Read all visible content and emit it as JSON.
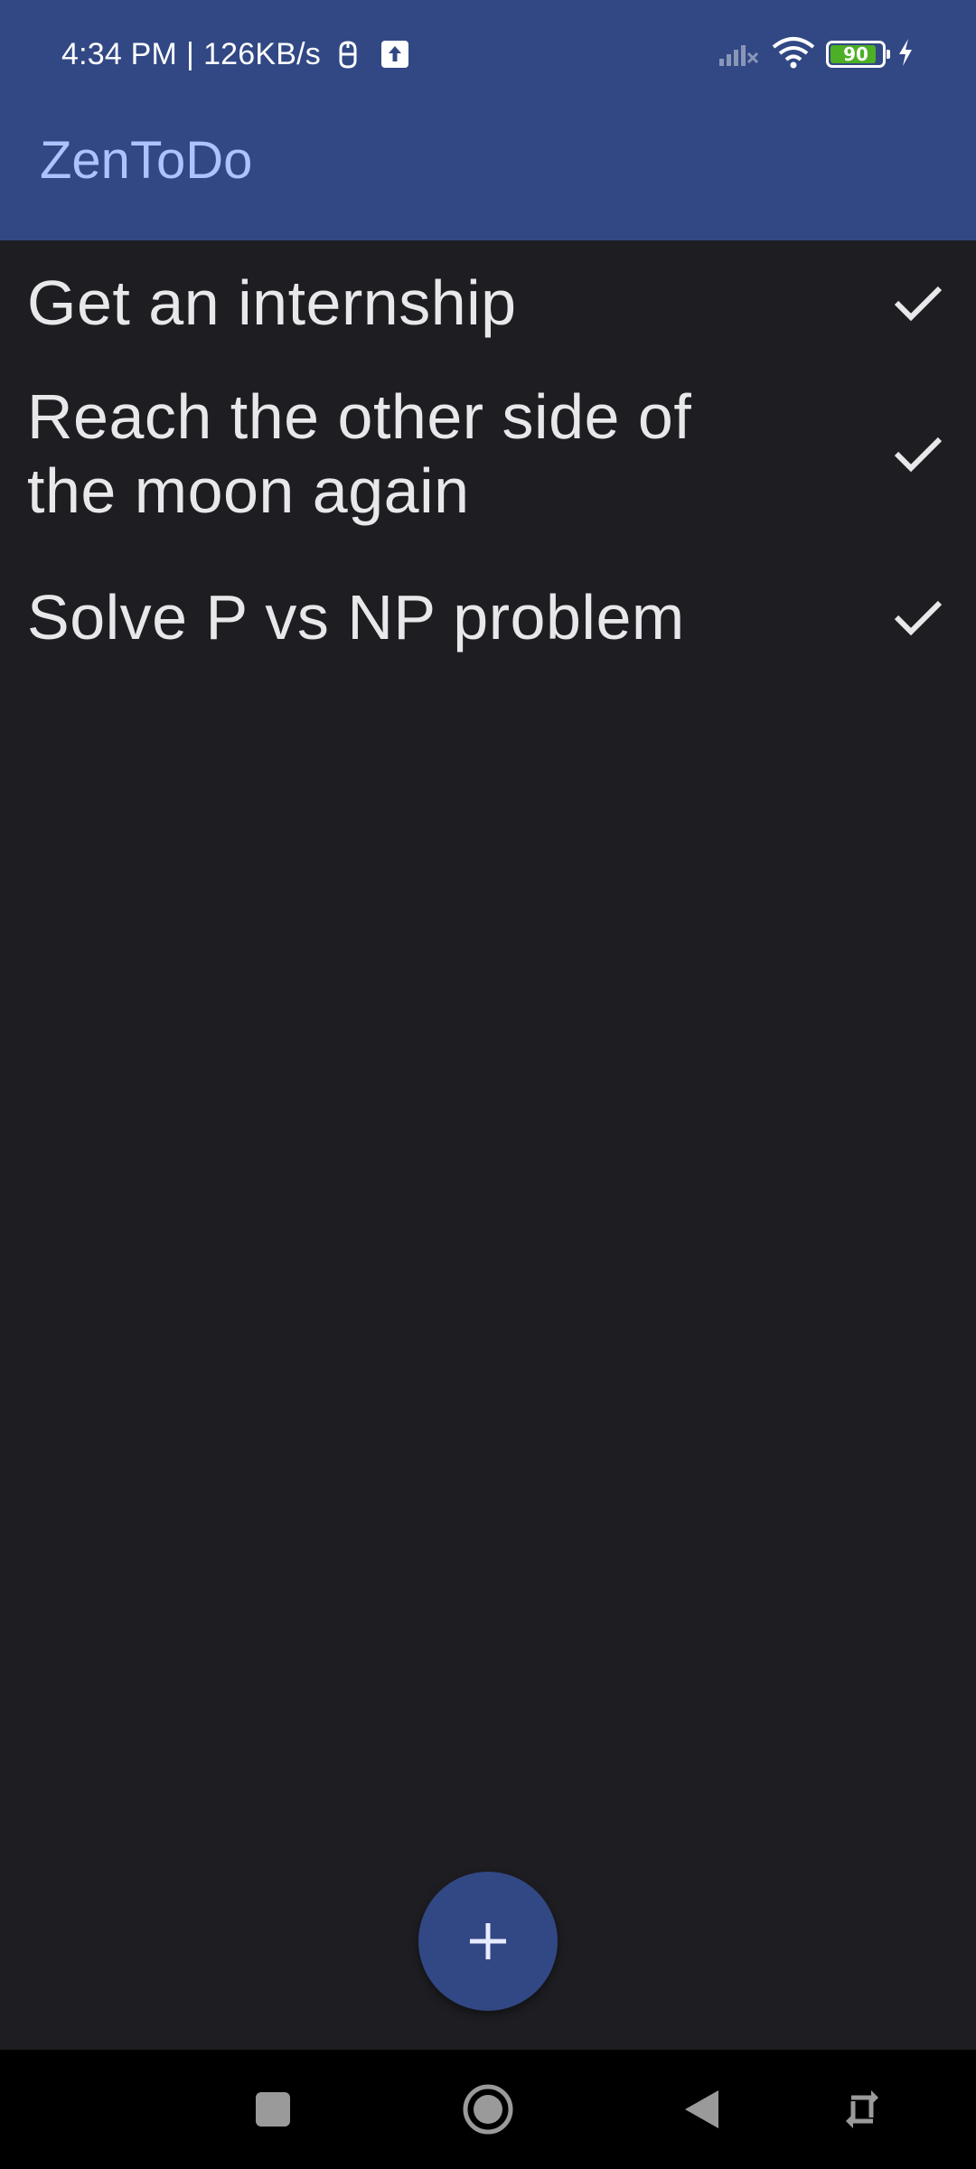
{
  "status_bar": {
    "time": "4:34 PM",
    "separator": "|",
    "net_speed": "126KB/s",
    "battery_level": "90",
    "battery_fill_fraction": 0.9,
    "icons": [
      "bug-icon",
      "upload-icon",
      "signal-icon",
      "wifi-icon",
      "battery-icon",
      "charging-icon"
    ]
  },
  "app_bar": {
    "title": "ZenToDo"
  },
  "tasks": [
    {
      "text": "Get an internship",
      "action_icon": "check-icon"
    },
    {
      "text": "Reach the other side of the moon again",
      "action_icon": "check-icon"
    },
    {
      "text": "Solve P vs NP problem",
      "action_icon": "check-icon"
    }
  ],
  "fab": {
    "icon": "plus-icon"
  },
  "nav_bar": {
    "icons": [
      "recents-icon",
      "home-icon",
      "back-icon",
      "rotate-icon"
    ]
  },
  "colors": {
    "header_bg": "#324884",
    "title": "#aec2ff",
    "background": "#1e1e22",
    "text": "#e8e8ea",
    "battery_green": "#4caf26"
  }
}
